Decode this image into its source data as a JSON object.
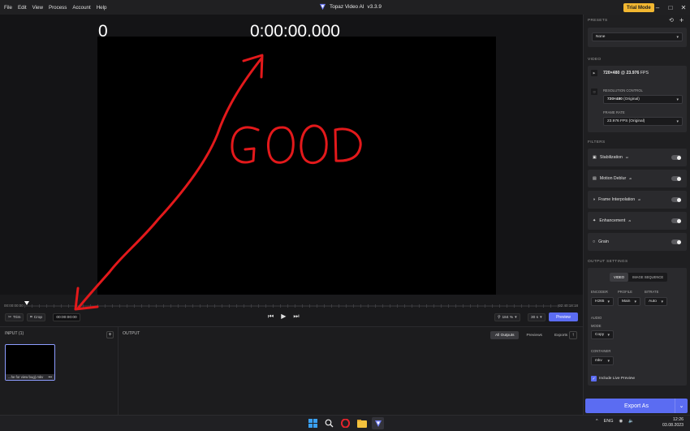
{
  "menu": [
    "File",
    "Edit",
    "View",
    "Process",
    "Account",
    "Help"
  ],
  "app": {
    "title": "Topaz Video AI",
    "version": "v3.3.9",
    "trial_label": "Trial Mode"
  },
  "video_overlay": {
    "counter": "0",
    "timecode": "0:00:00.000",
    "annotation": "GOOD"
  },
  "timeline": {
    "start": "00:00:00:00",
    "end": "02:40:18:18"
  },
  "controls": {
    "trim_label": "Trim",
    "crop_label": "Crop",
    "timecode": "00:00:00:00",
    "zoom": "184 %",
    "fps": "30 s",
    "preview_label": "Preview"
  },
  "input_panel": {
    "label": "INPUT (1)",
    "file_name": "...he for view bug).mkv",
    "more": "•••"
  },
  "output_panel": {
    "label": "OUTPUT",
    "tabs": [
      "All Outputs",
      "Previews",
      "Exports"
    ]
  },
  "sidebar": {
    "presets_label": "PRESETS",
    "preset_value": "None",
    "video_label": "VIDEO",
    "video_info": "720×480",
    "video_info_sep": "@",
    "video_fps": "23.976",
    "video_fps_unit": "FPS",
    "resolution_label": "RESOLUTION CONTROL",
    "resolution_value": "720×480",
    "resolution_suffix": "(Original)",
    "frame_rate_label": "FRAME RATE",
    "frame_rate_value": "23.976 FPS (Original)",
    "filters_label": "FILTERS",
    "filters": [
      {
        "name": "Stabilization",
        "sup": "AI"
      },
      {
        "name": "Motion Deblur",
        "sup": "AI"
      },
      {
        "name": "Frame Interpolation",
        "sup": "AI"
      },
      {
        "name": "Enhancement",
        "sup": "AI"
      },
      {
        "name": "Grain",
        "sup": ""
      }
    ],
    "output_settings_label": "OUTPUT SETTINGS",
    "output_mode_tabs": [
      "VIDEO",
      "IMAGE SEQUENCE"
    ],
    "encoder_label": "ENCODER",
    "encoder_value": "H265",
    "profile_label": "PROFILE",
    "profile_value": "Main",
    "bitrate_label": "BITRATE",
    "bitrate_value": "Auto",
    "audio_label": "AUDIO",
    "mode_label": "MODE",
    "mode_value": "Copy",
    "container_label": "CONTAINER",
    "container_value": "mkv",
    "live_preview_label": "Include Live Preview",
    "export_label": "Export As"
  },
  "taskbar": {
    "tray": [
      "^",
      "ENG"
    ],
    "time": "12:26",
    "date": "03.08.2023"
  },
  "colors": {
    "accent": "#5b6cf2",
    "trial": "#f2b731",
    "annotation": "#e3191b"
  }
}
